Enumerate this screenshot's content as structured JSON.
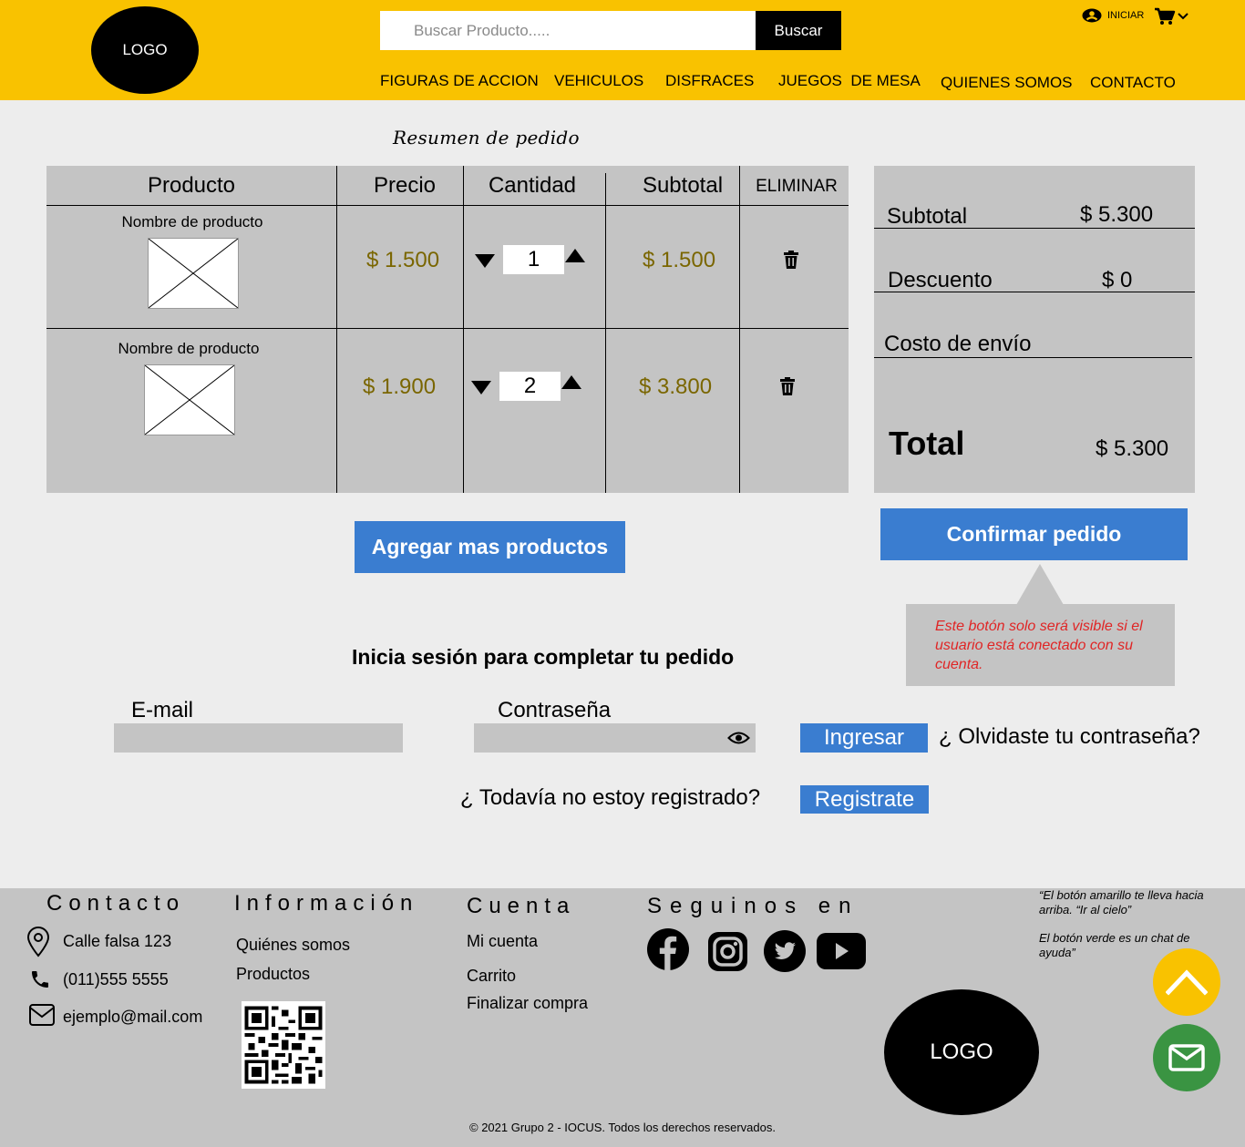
{
  "header": {
    "logo": "LOGO",
    "search_placeholder": "Buscar Producto.....",
    "search_button": "Buscar",
    "login_label": "INICIAR",
    "nav": [
      "FIGURAS DE ACCION",
      "VEHICULOS",
      "DISFRACES",
      "JUEGOS  DE MESA",
      "QUIENES SOMOS",
      "CONTACTO"
    ]
  },
  "main": {
    "title": "Resumen de pedido",
    "table": {
      "headers": [
        "Producto",
        "Precio",
        "Cantidad",
        "Subtotal",
        "ELIMINAR"
      ],
      "rows": [
        {
          "name": "Nombre de producto",
          "price": "$ 1.500",
          "qty": "1",
          "subtotal": "$ 1.500"
        },
        {
          "name": "Nombre de producto",
          "price": "$ 1.900",
          "qty": "2",
          "subtotal": "$ 3.800"
        }
      ]
    },
    "totals": {
      "subtotal_label": "Subtotal",
      "subtotal_value": "$ 5.300",
      "discount_label": "Descuento",
      "discount_value": "$ 0",
      "shipping_label": "Costo de envío",
      "total_label": "Total",
      "total_value": "$ 5.300"
    },
    "add_more_button": "Agregar mas productos",
    "confirm_button": "Confirmar pedido",
    "confirm_note": "Este botón solo será visible si el usuario está conectado con su cuenta.",
    "login": {
      "title": "Inicia sesión para completar tu pedido",
      "email_label": "E-mail",
      "password_label": "Contraseña",
      "login_button": "Ingresar",
      "forgot_link": "¿ Olvidaste tu contraseña?",
      "not_registered": "¿ Todavía no estoy registrado?",
      "register_button": "Registrate"
    }
  },
  "footer": {
    "contact_title": "Contacto",
    "address": "Calle falsa 123",
    "phone": "(011)555 5555",
    "email": "ejemplo@mail.com",
    "info_title": "Información",
    "info_items": [
      "Quiénes somos",
      "Productos"
    ],
    "account_title": "Cuenta",
    "account_items": [
      "Mi cuenta",
      "Carrito",
      "Finalizar compra"
    ],
    "follow_title": "Seguinos en",
    "social_icons": [
      "facebook-icon",
      "instagram-icon",
      "twitter-icon",
      "youtube-icon"
    ],
    "logo": "LOGO",
    "note_yellow": "“El botón amarillo te lleva hacia arriba. “Ir al cielo”",
    "note_green": "El botón verde es un chat de ayuda”",
    "copyright": "© 2021 Grupo 2 - IOCUS. Todos los derechos reservados.",
    "colors": {
      "yellow": "#f9c200",
      "green": "#3a9442",
      "blue": "#3a7dd0"
    }
  }
}
